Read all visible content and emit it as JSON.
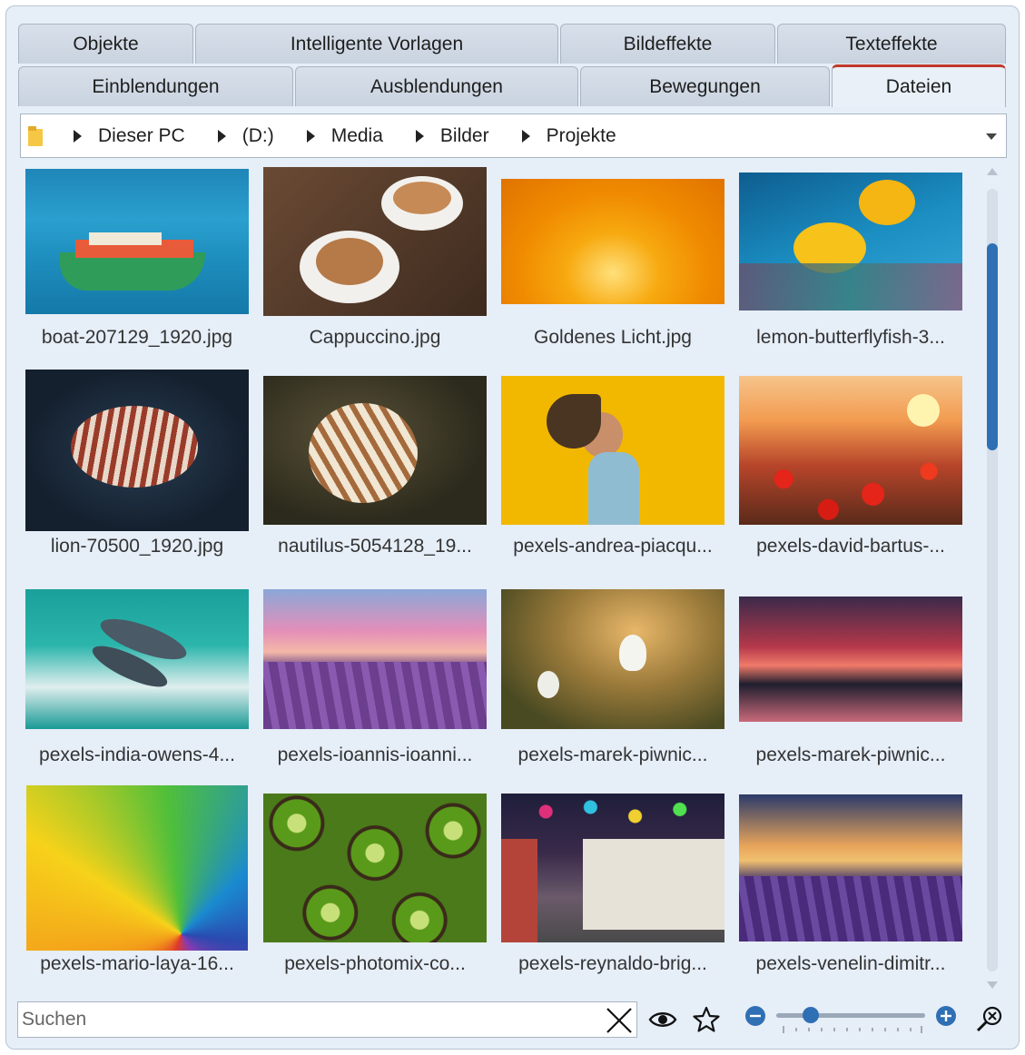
{
  "tabs_row1": [
    {
      "label": "Objekte"
    },
    {
      "label": "Intelligente Vorlagen"
    },
    {
      "label": "Bildeffekte"
    },
    {
      "label": "Texteffekte"
    }
  ],
  "tabs_row2": [
    {
      "label": "Einblendungen"
    },
    {
      "label": "Ausblendungen"
    },
    {
      "label": "Bewegungen"
    },
    {
      "label": "Dateien",
      "active": true
    }
  ],
  "breadcrumb": {
    "segments": [
      "Dieser PC",
      "(D:)",
      "Media",
      "Bilder",
      "Projekte"
    ]
  },
  "files": [
    {
      "label": "boat-207129_1920.jpg"
    },
    {
      "label": "Cappuccino.jpg"
    },
    {
      "label": "Goldenes Licht.jpg"
    },
    {
      "label": "lemon-butterflyfish-3..."
    },
    {
      "label": "lion-70500_1920.jpg"
    },
    {
      "label": "nautilus-5054128_19..."
    },
    {
      "label": "pexels-andrea-piacqu..."
    },
    {
      "label": "pexels-david-bartus-..."
    },
    {
      "label": "pexels-india-owens-4..."
    },
    {
      "label": "pexels-ioannis-ioanni..."
    },
    {
      "label": "pexels-marek-piwnic..."
    },
    {
      "label": "pexels-marek-piwnic..."
    },
    {
      "label": "pexels-mario-laya-16..."
    },
    {
      "label": "pexels-photomix-co..."
    },
    {
      "label": "pexels-reynaldo-brig..."
    },
    {
      "label": "pexels-venelin-dimitr..."
    }
  ],
  "search": {
    "placeholder": "Suchen",
    "value": ""
  },
  "zoom": {
    "level": 0.2
  },
  "colors": {
    "accent": "#2f6fb4",
    "active_tab_marker": "#c0392b",
    "panel_bg": "#e6eef8"
  }
}
